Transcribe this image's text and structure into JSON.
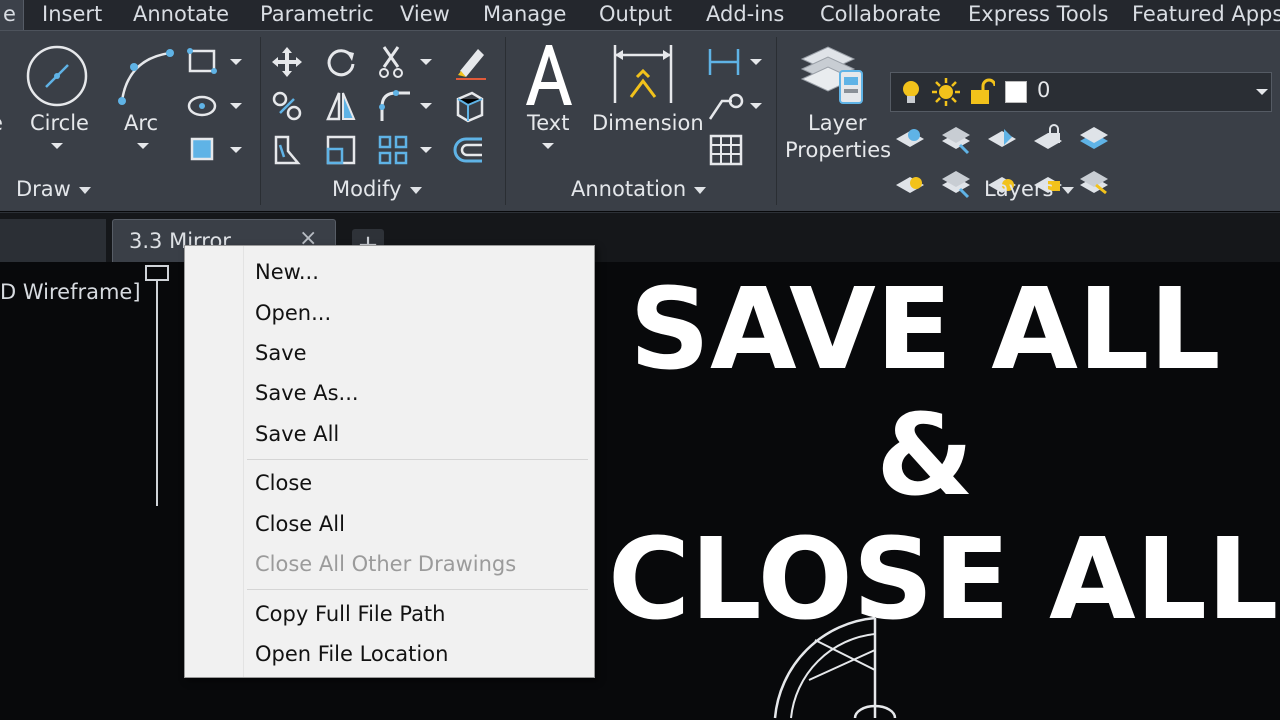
{
  "ribbon_tabs": [
    "e",
    "Insert",
    "Annotate",
    "Parametric",
    "View",
    "Manage",
    "Output",
    "Add-ins",
    "Collaborate",
    "Express Tools",
    "Featured Apps"
  ],
  "draw_panel": {
    "title": "Draw",
    "circle_label": "Circle",
    "arc_label": "Arc",
    "partial_label": "e"
  },
  "modify_panel": {
    "title": "Modify"
  },
  "annotation_panel": {
    "title": "Annotation",
    "text_label": "Text",
    "dimension_label": "Dimension"
  },
  "layers_panel": {
    "title": "Layers",
    "layer_properties_label_1": "Layer",
    "layer_properties_label_2": "Properties",
    "current_layer": "0"
  },
  "file_tab": {
    "label": "3.3 Mirror",
    "close_glyph": "×",
    "new_tab_glyph": "+"
  },
  "viewport": {
    "label": "D Wireframe]"
  },
  "context_menu": {
    "items": [
      {
        "label": "New..."
      },
      {
        "label": "Open..."
      },
      {
        "label": "Save"
      },
      {
        "label": "Save As..."
      },
      {
        "label": "Save All"
      },
      {
        "label": "Close"
      },
      {
        "label": "Close All"
      },
      {
        "label": "Close All Other Drawings",
        "disabled": true
      },
      {
        "label": "Copy Full File Path"
      },
      {
        "label": "Open File Location"
      }
    ]
  },
  "headline": {
    "line1": "SAVE ALL",
    "line2": "&",
    "line3": "CLOSE ALL"
  },
  "colors": {
    "ribbon_bg": "#3a3f47",
    "icon_blue": "#5fb3e6",
    "icon_yellow": "#f2c21b",
    "canvas_bg": "#08090b",
    "menu_bg": "#f1f1f1"
  }
}
